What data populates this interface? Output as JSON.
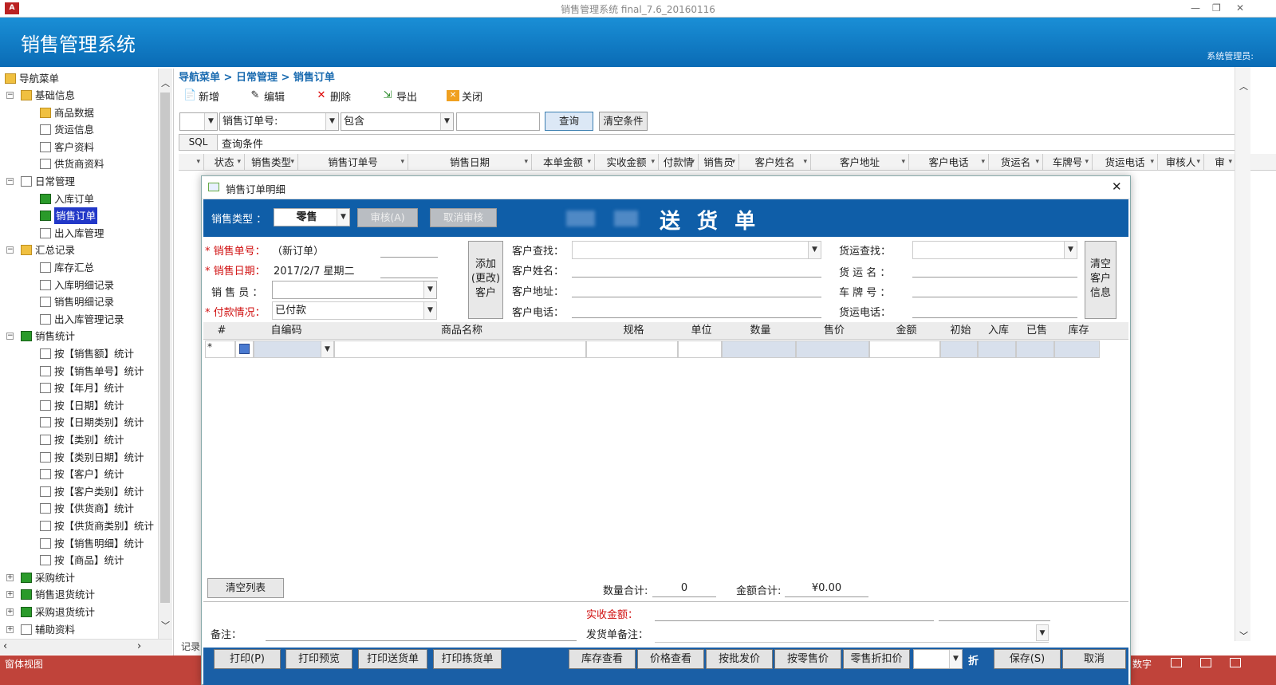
{
  "app": {
    "window_title": "销售管理系统 final_7.6_20160116",
    "banner_title": "销售管理系统",
    "admin_label": "系统管理员:",
    "status_left": "窗体视图",
    "status_right": "数字"
  },
  "nav": {
    "root": "导航菜单",
    "items": [
      {
        "label": "基础信息",
        "level": 1,
        "icon": "folder-open-icon",
        "expander": "−"
      },
      {
        "label": "商品数据",
        "level": 2,
        "icon": "product-icon"
      },
      {
        "label": "货运信息",
        "level": 2,
        "icon": "doc-icon"
      },
      {
        "label": "客户资料",
        "level": 2,
        "icon": "doc-icon"
      },
      {
        "label": "供货商资料",
        "level": 2,
        "icon": "doc-icon"
      },
      {
        "label": "日常管理",
        "level": 1,
        "icon": "folder-doc-icon",
        "expander": "−"
      },
      {
        "label": "入库订单",
        "level": 2,
        "icon": "form-icon"
      },
      {
        "label": "销售订单",
        "level": 2,
        "icon": "form-icon",
        "active": true
      },
      {
        "label": "出入库管理",
        "level": 2,
        "icon": "table-icon"
      },
      {
        "label": "汇总记录",
        "level": 1,
        "icon": "folder-icon",
        "expander": "−"
      },
      {
        "label": "库存汇总",
        "level": 2,
        "icon": "doc-icon"
      },
      {
        "label": "入库明细记录",
        "level": 2,
        "icon": "doc-icon"
      },
      {
        "label": "销售明细记录",
        "level": 2,
        "icon": "doc-icon"
      },
      {
        "label": "出入库管理记录",
        "level": 2,
        "icon": "doc-icon"
      },
      {
        "label": "销售统计",
        "level": 1,
        "icon": "green-book-icon",
        "expander": "−"
      },
      {
        "label": "按【销售额】统计",
        "level": 2,
        "icon": "doc-icon"
      },
      {
        "label": "按【销售单号】统计",
        "level": 2,
        "icon": "doc-icon"
      },
      {
        "label": "按【年月】统计",
        "level": 2,
        "icon": "doc-icon"
      },
      {
        "label": "按【日期】统计",
        "level": 2,
        "icon": "doc-icon"
      },
      {
        "label": "按【日期类别】统计",
        "level": 2,
        "icon": "doc-icon"
      },
      {
        "label": "按【类别】统计",
        "level": 2,
        "icon": "doc-icon"
      },
      {
        "label": "按【类别日期】统计",
        "level": 2,
        "icon": "doc-icon"
      },
      {
        "label": "按【客户】统计",
        "level": 2,
        "icon": "doc-icon"
      },
      {
        "label": "按【客户类别】统计",
        "level": 2,
        "icon": "doc-icon"
      },
      {
        "label": "按【供货商】统计",
        "level": 2,
        "icon": "doc-icon"
      },
      {
        "label": "按【供货商类别】统计",
        "level": 2,
        "icon": "doc-icon"
      },
      {
        "label": "按【销售明细】统计",
        "level": 2,
        "icon": "doc-icon"
      },
      {
        "label": "按【商品】统计",
        "level": 2,
        "icon": "doc-icon"
      },
      {
        "label": "采购统计",
        "level": 1,
        "icon": "green-book-icon",
        "expander": "+"
      },
      {
        "label": "销售退货统计",
        "level": 1,
        "icon": "green-book-icon",
        "expander": "+"
      },
      {
        "label": "采购退货统计",
        "level": 1,
        "icon": "green-book-icon",
        "expander": "+"
      },
      {
        "label": "辅助资料",
        "level": 1,
        "icon": "doc-icon",
        "expander": "+"
      }
    ]
  },
  "breadcrumb": "导航菜单 > 日常管理 > 销售订单",
  "toolbar": {
    "new": "新增",
    "edit": "编辑",
    "delete": "删除",
    "export": "导出",
    "close": "关闭"
  },
  "filter": {
    "field": "销售订单号:",
    "op": "包含",
    "value": "",
    "query": "查询",
    "clear": "清空条件",
    "sql": "SQL",
    "sql_text": "查询条件"
  },
  "grid_headers": [
    "状态",
    "销售类型",
    "销售订单号",
    "销售日期",
    "本单金额",
    "实收金额",
    "付款情",
    "销售员",
    "客户姓名",
    "客户地址",
    "客户电话",
    "货运名",
    "车牌号",
    "货运电话",
    "审核人",
    "审"
  ],
  "record_label": "记录",
  "dialog": {
    "title": "销售订单明细",
    "sale_type_label": "销售类型 ：",
    "sale_type_value": "零售",
    "audit": "审核(A)",
    "unaudit": "取消审核",
    "doc_title": "送 货 单",
    "order_no_label": "* 销售单号：",
    "order_no_value": "（新订单）",
    "date_label": "* 销售日期：",
    "date_value": "2017/2/7 星期二",
    "salesman_label": "销 售 员 ：",
    "salesman_value": "",
    "payment_label": "* 付款情况：",
    "payment_value": "已付款",
    "add_customer": "添加(更改)客户",
    "cust_search": "客户查找：",
    "cust_name": "客户姓名：",
    "cust_addr": "客户地址：",
    "cust_phone": "客户电话：",
    "ship_search": "货运查找：",
    "ship_name": "货 运 名 ：",
    "plate": "车 牌 号 ：",
    "ship_phone": "货运电话：",
    "clear_customer": "清空客户信息",
    "detail_headers": [
      "#",
      "自编码",
      "商品名称",
      "规格",
      "单位",
      "数量",
      "售价",
      "金额",
      "初始",
      "入库",
      "已售",
      "库存"
    ],
    "new_row_marker": "*",
    "clear_list": "清空列表",
    "qty_total_label": "数量合计:",
    "qty_total": "0",
    "amt_total_label": "金额合计:",
    "amt_total": "¥0.00",
    "received_label": "实收金额：",
    "remark_label": "备注：",
    "ship_remark_label": "发货单备注：",
    "footer_buttons": {
      "print": "打印(P)",
      "preview": "打印预览",
      "print_delivery": "打印送货单",
      "print_pick": "打印拣货单",
      "stock": "库存查看",
      "price": "价格查看",
      "wholesale": "按批发价",
      "retail": "按零售价",
      "retail_discount": "零售折扣价",
      "discount_unit": "折",
      "save": "保存(S)",
      "cancel": "取消"
    }
  },
  "colors": {
    "banner": "#0a6bb5",
    "dialog_band": "#0f5ea8",
    "status": "#c0433a",
    "required": "#d01010"
  }
}
